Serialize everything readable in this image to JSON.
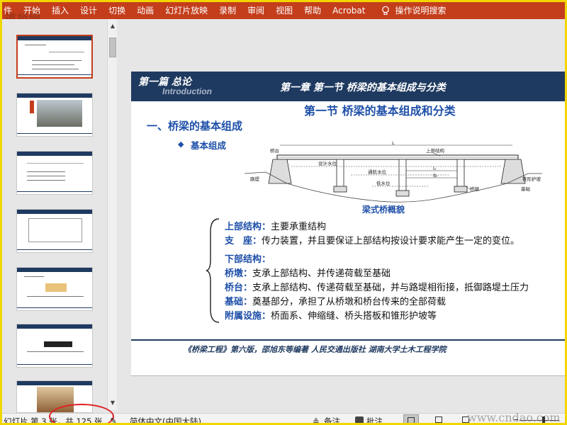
{
  "ribbon": {
    "tabs": [
      "件",
      "开始",
      "插入",
      "设计",
      "切换",
      "动画",
      "幻灯片放映",
      "录制",
      "审阅",
      "视图",
      "帮助",
      "Acrobat"
    ],
    "search_label": "操作说明搜索",
    "accent": "#c43e1c"
  },
  "watermark_top": "道桥网",
  "slide": {
    "part_title": "第一篇 总论",
    "intro": "Introduction",
    "chapter_title": "第一章 第一节  桥梁的基本组成与分类",
    "section_title": "第一节 桥梁的基本组成和分类",
    "heading1": "一、桥梁的基本组成",
    "heading2": "基本组成",
    "diagram": {
      "caption": "梁式桥概貌",
      "labels": {
        "abutment": "桥台",
        "superstructure": "上部结构",
        "design_water": "设计水位",
        "nav_water": "通航水位",
        "low_water": "低水位",
        "road_embankment": "路堤",
        "pier": "桥墩",
        "cone_slope": "锥形护坡",
        "foundation": "基础",
        "span_L": "L",
        "span_l0": "l₀",
        "span_lb": "lb"
      }
    },
    "lines": [
      {
        "label": "上部结构：",
        "text": "主要承重结构"
      },
      {
        "label": "支　座：",
        "text": "传力装置，并且要保证上部结构按设计要求能产生一定的变位。"
      },
      {
        "label": "下部结构：",
        "text": ""
      },
      {
        "label": "桥墩：",
        "text": "支承上部结构、并传递荷载至基础"
      },
      {
        "label": "桥台：",
        "text": "支承上部结构、传递荷载至基础，并与路堤相衔接，抵御路堤土压力"
      },
      {
        "label": "基础：",
        "text": "奠基部分，承担了从桥墩和桥台传来的全部荷载"
      },
      {
        "label": "附属设施：",
        "text": "桥面系、伸缩缝、桥头搭板和锥形护坡等"
      }
    ],
    "footer": "《桥梁工程》第六版，邵旭东等编著      人民交通出版社      湖南大学土木工程学院"
  },
  "status": {
    "page_info": "幻灯片 第 3 张，共 125 张",
    "language": "简体中文(中国大陆)",
    "notes": "备注",
    "comments": "批注",
    "watermark": "www.cndao.com"
  }
}
